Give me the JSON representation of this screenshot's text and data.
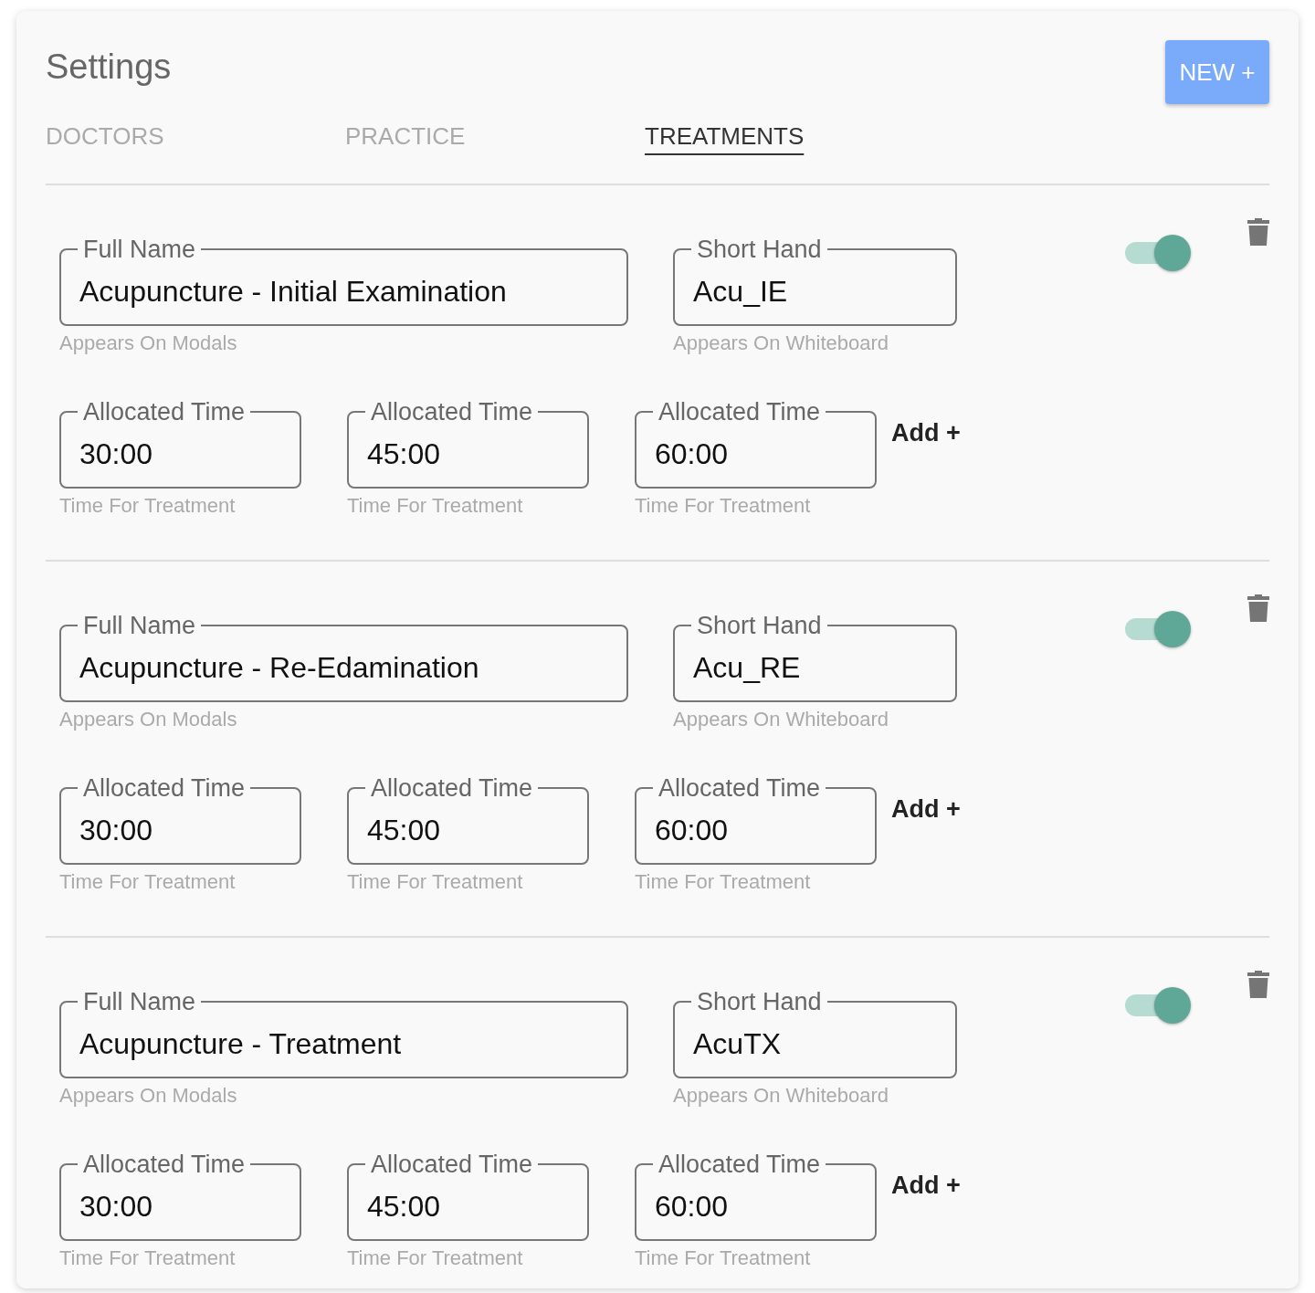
{
  "page": {
    "title": "Settings",
    "new_button": "NEW +"
  },
  "tabs": [
    {
      "label": "DOCTORS",
      "selected": false
    },
    {
      "label": "PRACTICE",
      "selected": false
    },
    {
      "label": "TREATMENTS",
      "selected": true
    }
  ],
  "treatments": [
    {
      "full_name": {
        "label": "Full Name",
        "value": "Acupuncture - Initial Examination",
        "helper": "Appears On Modals"
      },
      "short_hand": {
        "label": "Short Hand",
        "value": "Acu_IE",
        "helper": "Appears On Whiteboard"
      },
      "on": true,
      "times": [
        {
          "label": "Allocated Time",
          "value": "30:00",
          "helper": "Time For Treatment"
        },
        {
          "label": "Allocated Time",
          "value": "45:00",
          "helper": "Time For Treatment"
        },
        {
          "label": "Allocated Time",
          "value": "60:00",
          "helper": "Time For Treatment"
        }
      ],
      "add_label": "Add +"
    },
    {
      "full_name": {
        "label": "Full Name",
        "value": "Acupuncture - Re-Edamination",
        "helper": "Appears On Modals"
      },
      "short_hand": {
        "label": "Short Hand",
        "value": "Acu_RE",
        "helper": "Appears On Whiteboard"
      },
      "on": true,
      "times": [
        {
          "label": "Allocated Time",
          "value": "30:00",
          "helper": "Time For Treatment"
        },
        {
          "label": "Allocated Time",
          "value": "45:00",
          "helper": "Time For Treatment"
        },
        {
          "label": "Allocated Time",
          "value": "60:00",
          "helper": "Time For Treatment"
        }
      ],
      "add_label": "Add +"
    },
    {
      "full_name": {
        "label": "Full Name",
        "value": "Acupuncture - Treatment",
        "helper": "Appears On Modals"
      },
      "short_hand": {
        "label": "Short Hand",
        "value": "AcuTX",
        "helper": "Appears On Whiteboard"
      },
      "on": true,
      "times": [
        {
          "label": "Allocated Time",
          "value": "30:00",
          "helper": "Time For Treatment"
        },
        {
          "label": "Allocated Time",
          "value": "45:00",
          "helper": "Time For Treatment"
        },
        {
          "label": "Allocated Time",
          "value": "60:00",
          "helper": "Time For Treatment"
        }
      ],
      "add_label": "Add +"
    }
  ]
}
